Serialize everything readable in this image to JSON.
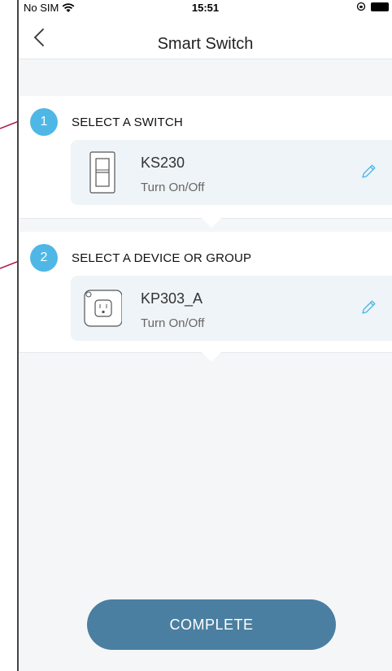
{
  "status_bar": {
    "carrier": "No SIM",
    "time": "15:51"
  },
  "nav": {
    "title": "Smart Switch"
  },
  "steps": [
    {
      "number": "1",
      "label": "SELECT A SWITCH",
      "device_name": "KS230",
      "device_action": "Turn On/Off",
      "icon": "switch-icon"
    },
    {
      "number": "2",
      "label": "SELECT A DEVICE OR GROUP",
      "device_name": "KP303_A",
      "device_action": "Turn On/Off",
      "icon": "outlet-icon"
    }
  ],
  "complete_button": {
    "label": "COMPLETE"
  },
  "colors": {
    "step_accent": "#4fb7e6",
    "primary_button": "#4a7fa1",
    "card_background": "#eff4f8",
    "annotation": "#b0154a"
  }
}
